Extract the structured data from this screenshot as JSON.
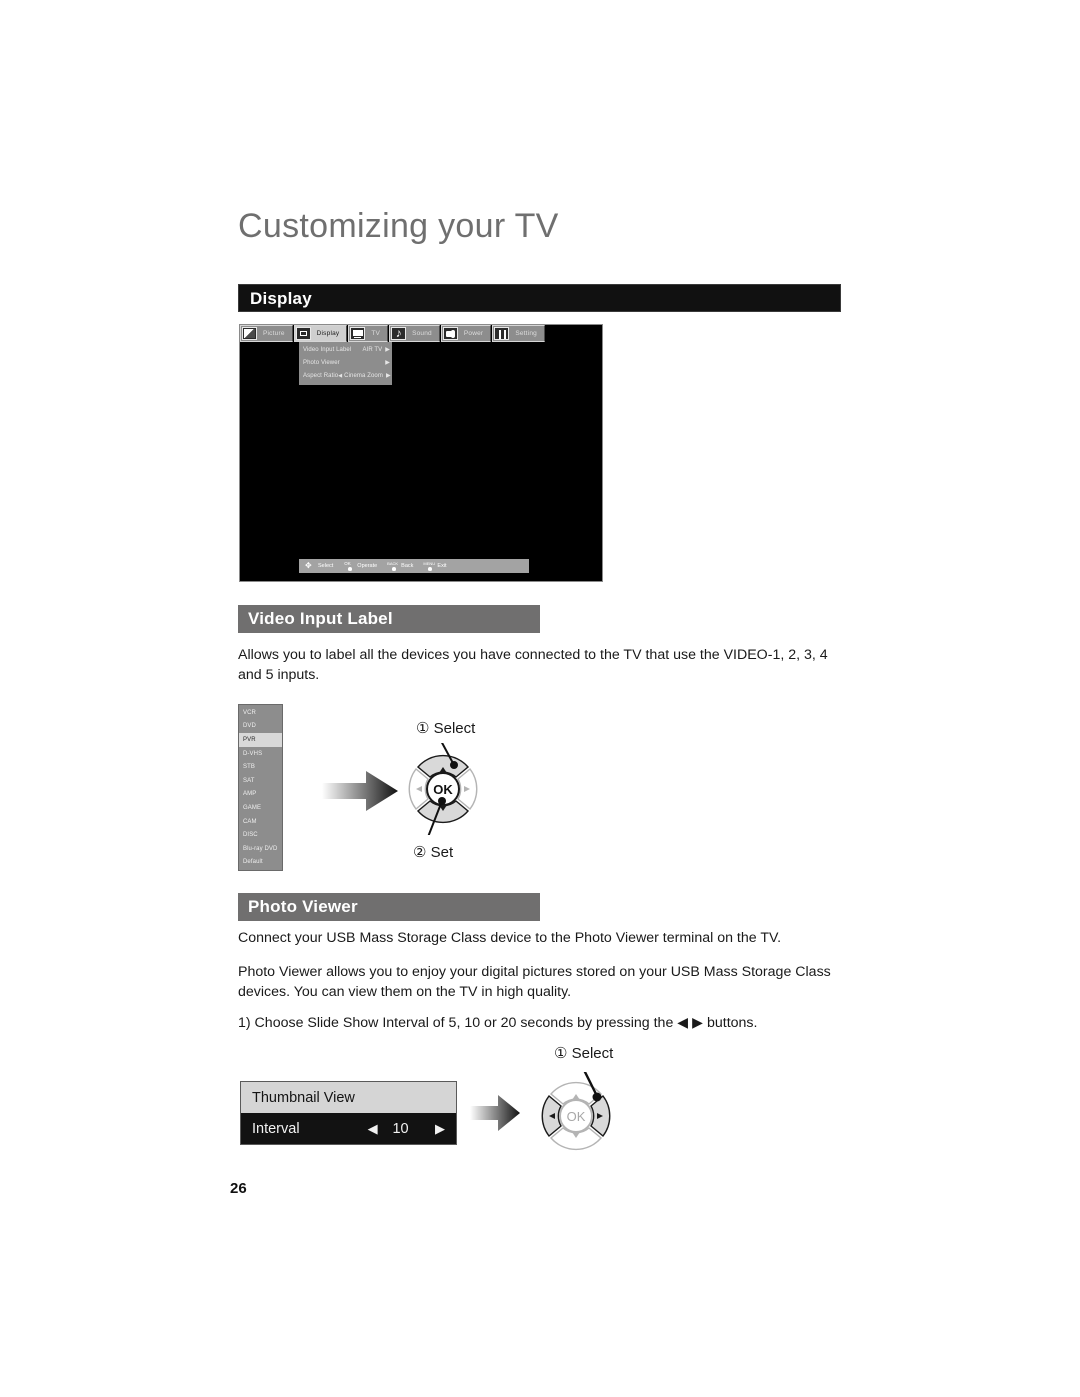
{
  "page": {
    "title": "Customizing your TV",
    "number": "26"
  },
  "display_section": {
    "header": "Display",
    "osd": {
      "tabs": [
        {
          "label": "Picture",
          "icon": "picture-icon",
          "selected": false
        },
        {
          "label": "Display",
          "icon": "display-icon",
          "selected": true
        },
        {
          "label": "TV",
          "icon": "tv-icon",
          "selected": false
        },
        {
          "label": "Sound",
          "icon": "sound-note-icon",
          "selected": false
        },
        {
          "label": "Power",
          "icon": "power-plug-icon",
          "selected": false
        },
        {
          "label": "Setting",
          "icon": "setting-tools-icon",
          "selected": false
        }
      ],
      "submenu": [
        {
          "name": "Video Input Label",
          "value": "AIR TV",
          "left_caret": false,
          "right_caret": true
        },
        {
          "name": "Photo Viewer",
          "value": "",
          "left_caret": false,
          "right_caret": true
        },
        {
          "name": "Aspect Ratio",
          "value": "Cinema Zoom",
          "left_caret": true,
          "right_caret": true
        }
      ],
      "help_bar": [
        {
          "key": "select-pad-key",
          "label": "Select"
        },
        {
          "key": "ok-button-key",
          "label": "Operate"
        },
        {
          "key": "back-button-key",
          "label": "Back"
        },
        {
          "key": "menu-button-key",
          "label": "Exit"
        }
      ]
    }
  },
  "video_input_label_section": {
    "header": "Video Input Label",
    "paragraph": "Allows you to label all the devices you have connected to the TV that use the VIDEO-1, 2, 3, 4 and 5 inputs.",
    "input_labels": [
      {
        "label": "VCR",
        "selected": false
      },
      {
        "label": "DVD",
        "selected": false
      },
      {
        "label": "PVR",
        "selected": true
      },
      {
        "label": "D-VHS",
        "selected": false
      },
      {
        "label": "STB",
        "selected": false
      },
      {
        "label": "SAT",
        "selected": false
      },
      {
        "label": "AMP",
        "selected": false
      },
      {
        "label": "GAME",
        "selected": false
      },
      {
        "label": "CAM",
        "selected": false
      },
      {
        "label": "DISC",
        "selected": false
      },
      {
        "label": "Blu-ray DVD",
        "selected": false
      },
      {
        "label": "Default",
        "selected": false
      }
    ],
    "callouts": {
      "select": "① Select",
      "set": "② Set"
    },
    "dpad": {
      "ok_label": "OK",
      "highlighted": "up-down"
    }
  },
  "photo_viewer_section": {
    "header": "Photo Viewer",
    "paragraph_1": "Connect your USB Mass Storage Class device to the Photo Viewer terminal on the TV.",
    "paragraph_2": "Photo Viewer allows you to enjoy your digital pictures stored on your USB Mass Storage Class devices.  You can view them on the TV in high quality.",
    "step_1": "1)  Choose Slide Show Interval of 5, 10 or 20 seconds by pressing the ◀ ▶ buttons.",
    "panel": {
      "title_row": "Thumbnail View",
      "setting_name": "Interval",
      "setting_value": "10",
      "left_caret": "◀",
      "right_caret": "▶"
    },
    "callouts": {
      "select": "① Select"
    },
    "dpad": {
      "ok_label": "OK",
      "highlighted": "left-right"
    }
  }
}
